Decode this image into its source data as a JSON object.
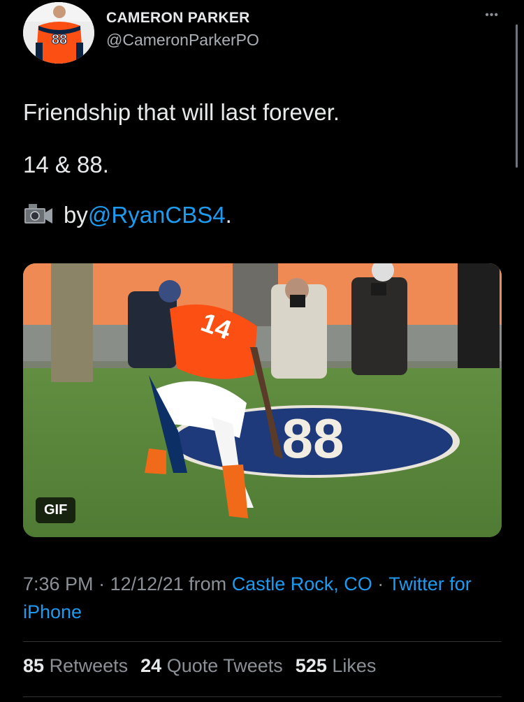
{
  "author": {
    "display_name": "CAMERON PARKER",
    "handle": "@CameronParkerPO",
    "jersey_number": "88"
  },
  "tweet": {
    "line1": "Friendship that will last forever.",
    "line2": "14 & 88.",
    "line3_prefix": "by ",
    "line3_mention": "@RyanCBS4",
    "line3_suffix": "."
  },
  "media": {
    "badge": "GIF",
    "jersey_number": "14",
    "logo_number": "88"
  },
  "meta": {
    "time": "7:36 PM",
    "separator": " · ",
    "date": "12/12/21",
    "from_text": " from ",
    "location": "Castle Rock, CO",
    "separator2": " · ",
    "source": "Twitter for iPhone"
  },
  "stats": {
    "retweets_count": "85",
    "retweets_label": "Retweets",
    "quotes_count": "24",
    "quotes_label": "Quote Tweets",
    "likes_count": "525",
    "likes_label": "Likes"
  },
  "icons": {
    "more": "more-options-icon",
    "camera": "video-camera-icon"
  },
  "colors": {
    "background": "#000000",
    "link": "#1d9bf0",
    "text": "#e7e9ea",
    "secondary": "#8b9096"
  }
}
